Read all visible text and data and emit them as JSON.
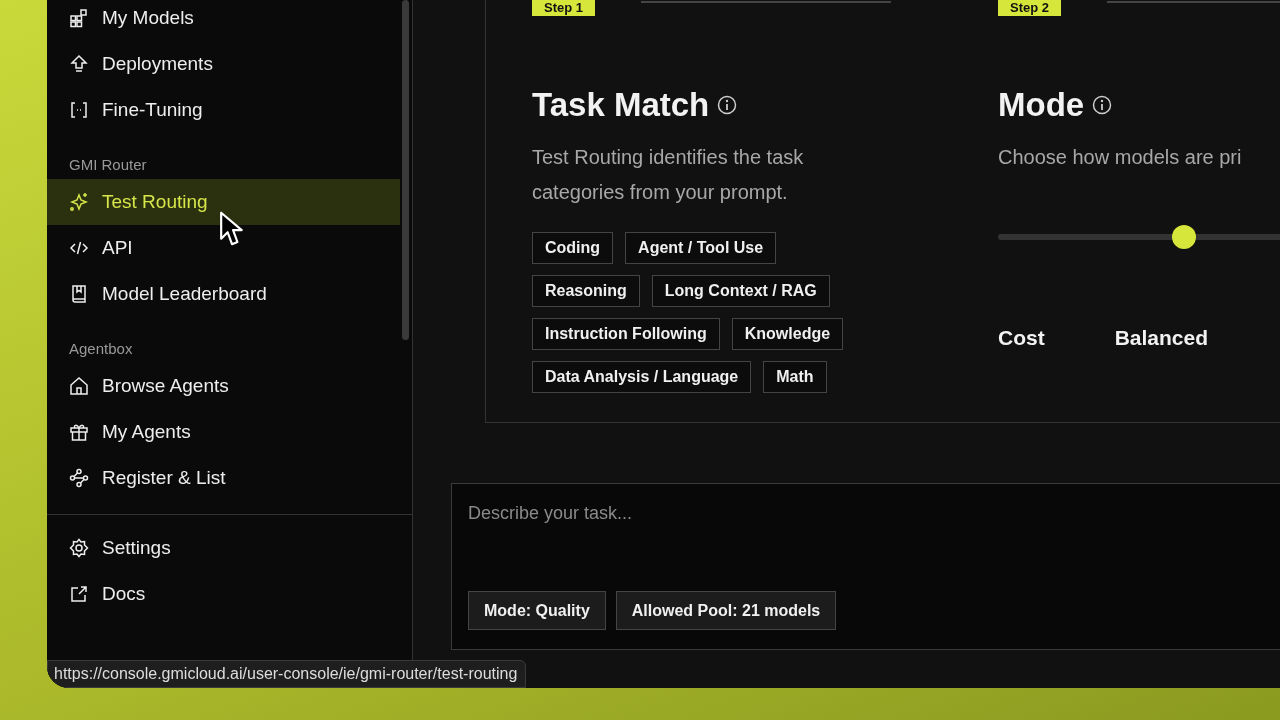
{
  "sidebar": {
    "groups": [
      {
        "items": [
          {
            "label": "My Models",
            "selected": false
          },
          {
            "label": "Deployments",
            "selected": false
          },
          {
            "label": "Fine-Tuning",
            "selected": false
          }
        ]
      },
      {
        "label": "GMI Router",
        "items": [
          {
            "label": "Test Routing",
            "selected": true
          },
          {
            "label": "API",
            "selected": false
          },
          {
            "label": "Model Leaderboard",
            "selected": false
          }
        ]
      },
      {
        "label": "Agentbox",
        "items": [
          {
            "label": "Browse Agents",
            "selected": false
          },
          {
            "label": "My Agents",
            "selected": false
          },
          {
            "label": "Register & List",
            "selected": false
          }
        ]
      }
    ],
    "footer": [
      {
        "label": "Settings",
        "selected": false
      },
      {
        "label": "Docs",
        "selected": false
      }
    ]
  },
  "steps": [
    {
      "badge": "Step 1",
      "title": "Task Match",
      "description": "Test Routing identifies the task categories from your prompt.",
      "tags": [
        "Coding",
        "Agent / Tool Use",
        "Reasoning",
        "Long Context / RAG",
        "Instruction Following",
        "Knowledge",
        "Data Analysis / Language",
        "Math"
      ]
    },
    {
      "badge": "Step 2",
      "title": "Mode",
      "description": "Choose how models are pri",
      "slider": {
        "level": 0.5
      },
      "options": [
        "Cost",
        "Balanced"
      ]
    }
  ],
  "prompt": {
    "placeholder": "Describe your task...",
    "chips": [
      "Mode: Quality",
      "Allowed Pool: 21 models"
    ]
  },
  "status_url": "https://console.gmicloud.ai/user-console/ie/gmi-router/test-routing"
}
